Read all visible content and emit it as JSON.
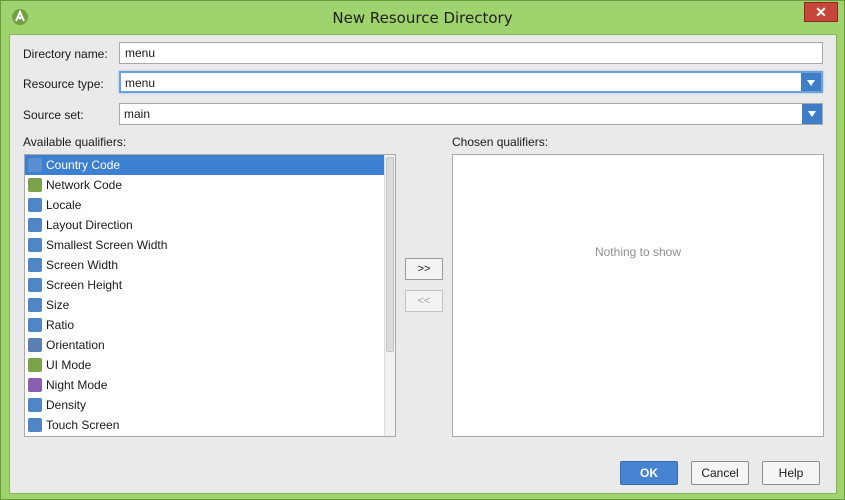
{
  "window": {
    "title": "New Resource Directory"
  },
  "form": {
    "directory_name_label": "Directory name:",
    "directory_name_value": "menu",
    "resource_type_label": "Resource type:",
    "resource_type_value": "menu",
    "source_set_label": "Source set:",
    "source_set_value": "main"
  },
  "available": {
    "label": "Available qualifiers:",
    "items": [
      {
        "label": "Country Code",
        "icon": "country-code-icon",
        "selected": true
      },
      {
        "label": "Network Code",
        "icon": "network-code-icon"
      },
      {
        "label": "Locale",
        "icon": "globe-icon"
      },
      {
        "label": "Layout Direction",
        "icon": "layout-direction-icon"
      },
      {
        "label": "Smallest Screen Width",
        "icon": "smallest-width-icon"
      },
      {
        "label": "Screen Width",
        "icon": "screen-width-icon"
      },
      {
        "label": "Screen Height",
        "icon": "screen-height-icon"
      },
      {
        "label": "Size",
        "icon": "size-icon"
      },
      {
        "label": "Ratio",
        "icon": "ratio-icon"
      },
      {
        "label": "Orientation",
        "icon": "orientation-icon"
      },
      {
        "label": "UI Mode",
        "icon": "ui-mode-icon"
      },
      {
        "label": "Night Mode",
        "icon": "night-mode-icon"
      },
      {
        "label": "Density",
        "icon": "density-icon"
      },
      {
        "label": "Touch Screen",
        "icon": "touch-screen-icon"
      }
    ]
  },
  "chosen": {
    "label": "Chosen qualifiers:",
    "empty_text": "Nothing to show"
  },
  "transfer": {
    "add_label": ">>",
    "remove_label": "<<"
  },
  "buttons": {
    "ok": "OK",
    "cancel": "Cancel",
    "help": "Help"
  },
  "colors": {
    "accent": "#3d7fd1",
    "title_bar": "#9fd36d",
    "close": "#c7463b"
  }
}
